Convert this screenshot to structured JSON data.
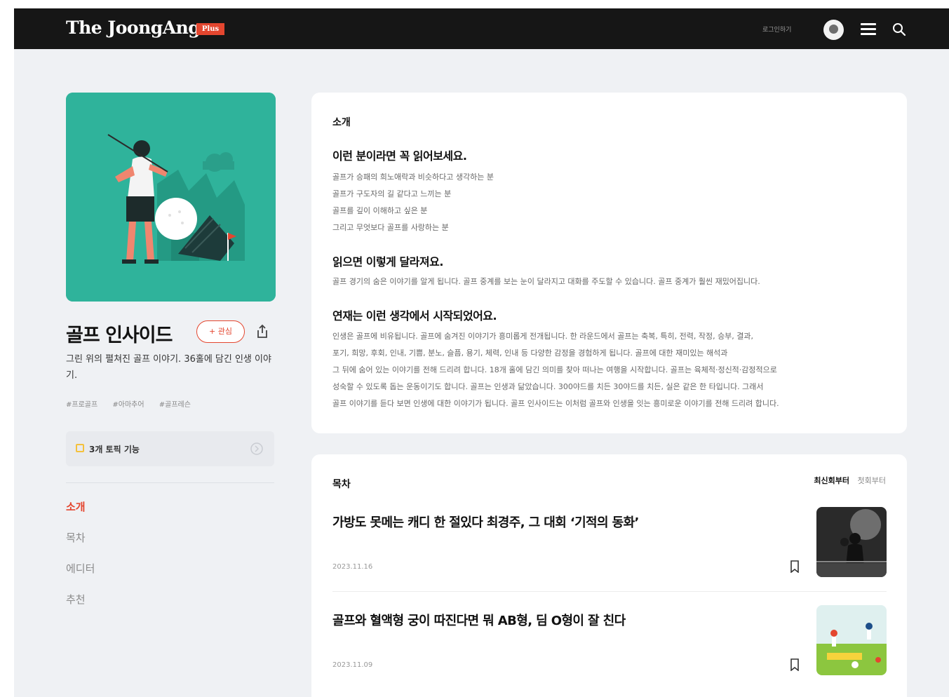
{
  "header": {
    "logo": "The JoongAng",
    "logo_badge": "Plus",
    "login_label": "로그인하기"
  },
  "series": {
    "title": "골프 인사이드",
    "follow_label": "+ 관심",
    "description": "그린 위의 펼쳐진 골프 이야기. 36홀에 담긴 인생 이야기.",
    "tags": [
      "#프로골프",
      "#아마추어",
      "#골프레슨"
    ],
    "benefit_label": "3개 토픽 기능"
  },
  "side_nav": [
    {
      "label": "소개",
      "active": true
    },
    {
      "label": "목차",
      "active": false
    },
    {
      "label": "에디터",
      "active": false
    },
    {
      "label": "추천",
      "active": false
    }
  ],
  "intro": {
    "section_label": "소개",
    "h1": "이런 분이라면 꼭 읽어보세요.",
    "list": [
      "골프가 승패의 희노애락과 비슷하다고 생각하는 분",
      "골프가 구도자의 길 같다고 느끼는 분",
      "골프를 깊이 이해하고 싶은 분",
      "그리고 무엇보다 골프를 사랑하는 분"
    ],
    "h2": "읽으면 이렇게 달라져요.",
    "p2": "골프 경기의 숨은 이야기를 알게 됩니다. 골프 중계를 보는 눈이 달라지고 대화를 주도할 수 있습니다. 골프 중계가 훨씬 재밌어집니다.",
    "h3": "연재는 이런 생각에서 시작되었어요.",
    "p3": [
      "인생은 골프에 비유됩니다. 골프에 숨겨진 이야기가 흥미롭게 전개됩니다. 한 라운드에서 골프는 축복, 특히, 전력, 작정, 승부, 결과,",
      "포기, 희망, 후회, 인내, 기쁨, 분노, 슬픔, 용기, 체력, 인내 등 다양한 감정을 경험하게 됩니다. 골프에 대한 재미있는 해석과",
      "그 뒤에 숨어 있는 이야기를 전해 드리려 합니다. 18개 홀에 담긴 의미를 찾아 떠나는 여행을 시작합니다. 골프는 육체적·정신적·감정적으로",
      "성숙할 수 있도록 돕는 운동이기도 합니다. 골프는 인생과 닮았습니다. 300야드를 치든 30야드를 치든, 실은 같은 한 타입니다. 그래서",
      "골프 이야기를 듣다 보면 인생에 대한 이야기가 됩니다. 골프 인사이드는 이처럼 골프와 인생을 잇는 흥미로운 이야기를 전해 드리려 합니다."
    ]
  },
  "toc": {
    "section_label": "목차",
    "sort_active": "최신회부터",
    "sort_other": "첫회부터",
    "articles": [
      {
        "title": "가방도 못메는 캐디 한 절있다 최경주, 그 대회 ‘기적의 동화’",
        "date": "2023.11.16"
      },
      {
        "title": "골프와 혈액형 궁이 따진다면 뭐 AB형, 딤 O형이 잘 친다",
        "date": "2023.11.09"
      }
    ]
  },
  "colors": {
    "accent": "#e4462f",
    "topbar": "#161616",
    "cover": "#2fb39b",
    "page_bg": "#eff1f4"
  }
}
